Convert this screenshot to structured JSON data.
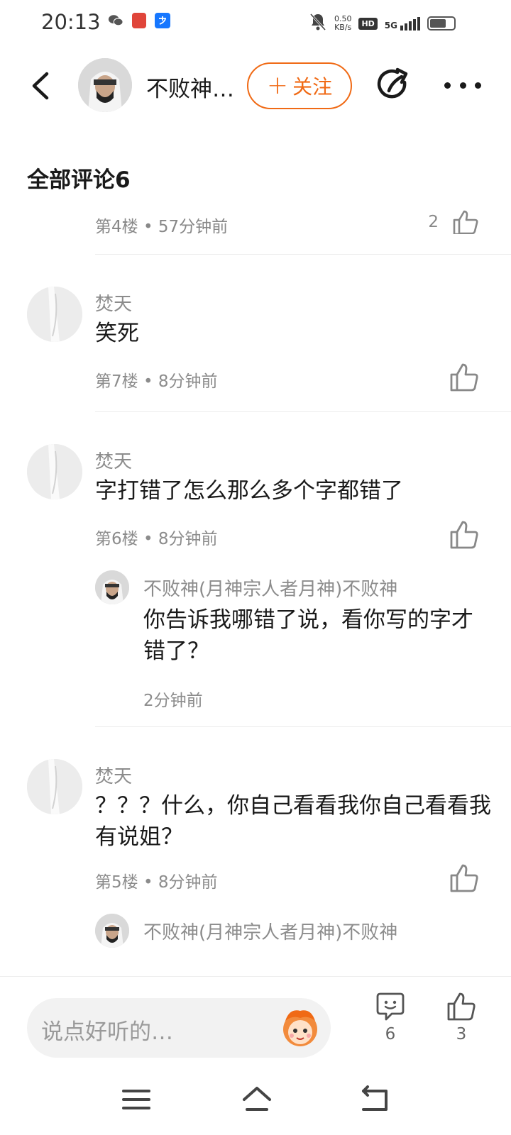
{
  "status_bar": {
    "time": "20:13",
    "left_icons": [
      "wechat-icon",
      "app-badge-icon",
      "alipay-icon"
    ],
    "network_speed_value": "0.50",
    "network_speed_unit": "KB/s",
    "hd_label": "HD",
    "signal_label": "5G",
    "battery_level": 0.7
  },
  "header": {
    "name": "不败神…",
    "follow_label": "关注",
    "accent_color": "#f06a15"
  },
  "section_title": "全部评论6",
  "cut_row": {
    "meta": "第4楼 • 57分钟前",
    "like_count": "2"
  },
  "comments": [
    {
      "user": "焚天",
      "text": "笑死",
      "meta": "第7楼 • 8分钟前"
    },
    {
      "user": "焚天",
      "text": "字打错了怎么那么多个字都错了",
      "meta": "第6楼 • 8分钟前",
      "reply": {
        "user": "不败神(月神宗人者月神)不败神",
        "text": "你告诉我哪错了说，看你写的字才错了？",
        "time": "2分钟前"
      }
    },
    {
      "user": "焚天",
      "text": "？？？什么，你自己看看我你自己看看我有说姐？",
      "meta": "第5楼 • 8分钟前",
      "reply": {
        "user": "不败神(月神宗人者月神)不败神"
      }
    }
  ],
  "bottom_bar": {
    "input_placeholder": "说点好听的…",
    "comment_count": "6",
    "like_count": "3"
  }
}
